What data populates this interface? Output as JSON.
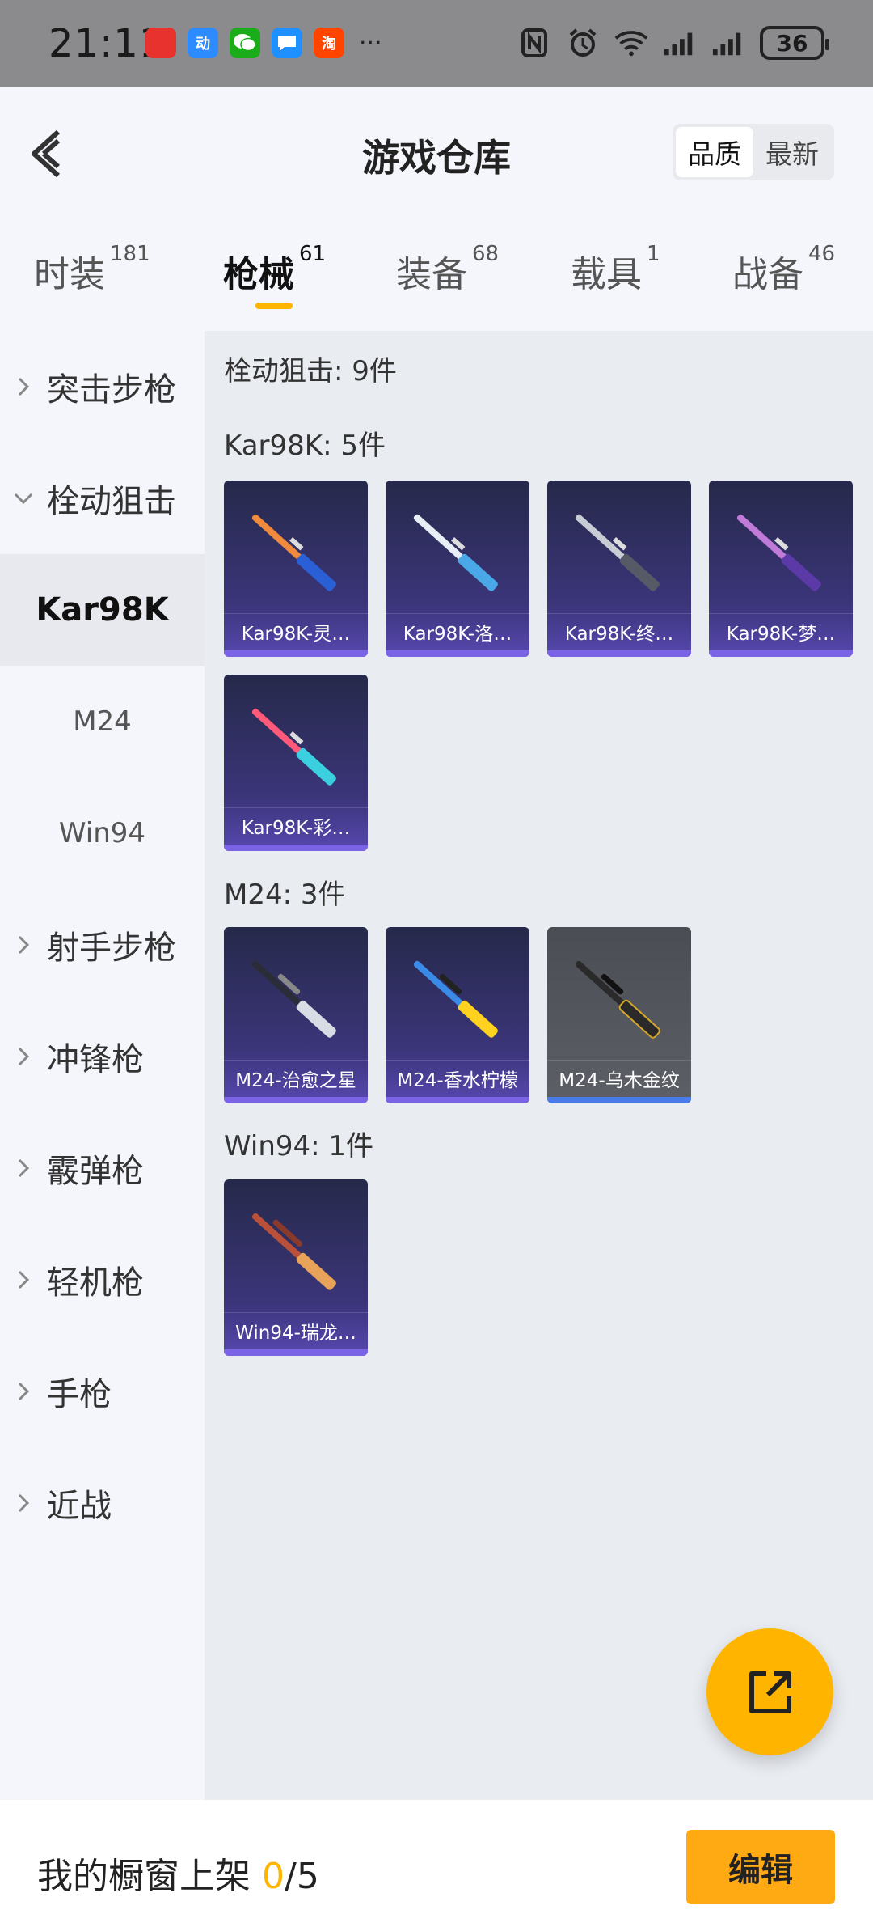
{
  "status_bar": {
    "time": "21:11",
    "apps": [
      {
        "icon": "game-app-icon",
        "text": "",
        "color": "#e8322d"
      },
      {
        "icon": "app-icon-blue",
        "text": "动",
        "color": "#2c8bff"
      },
      {
        "icon": "wechat-icon",
        "text": "",
        "color": "#1aad19"
      },
      {
        "icon": "message-icon",
        "text": "",
        "color": "#1e90ff"
      },
      {
        "icon": "taobao-icon",
        "text": "淘",
        "color": "#ff4400"
      }
    ],
    "more": "···",
    "battery": "36"
  },
  "header": {
    "title": "游戏仓库",
    "sort_options": [
      "品质",
      "最新"
    ],
    "sort_active": "品质"
  },
  "tabs": [
    {
      "label": "时装",
      "count": "181"
    },
    {
      "label": "枪械",
      "count": "61",
      "active": true
    },
    {
      "label": "装备",
      "count": "68"
    },
    {
      "label": "载具",
      "count": "1"
    },
    {
      "label": "战备",
      "count": "46"
    }
  ],
  "sidebar": {
    "categories": [
      {
        "label": "突击步枪",
        "expanded": false
      },
      {
        "label": "栓动狙击",
        "expanded": true
      },
      {
        "label": "射手步枪",
        "expanded": false
      },
      {
        "label": "冲锋枪",
        "expanded": false
      },
      {
        "label": "霰弹枪",
        "expanded": false
      },
      {
        "label": "轻机枪",
        "expanded": false
      },
      {
        "label": "手枪",
        "expanded": false
      },
      {
        "label": "近战",
        "expanded": false
      }
    ],
    "subitems": [
      {
        "label": "Kar98K",
        "active": true
      },
      {
        "label": "M24",
        "active": false
      },
      {
        "label": "Win94",
        "active": false
      }
    ]
  },
  "content": {
    "category_summary": "栓动狙击: 9件",
    "groups": [
      {
        "title": "Kar98K: 5件",
        "items": [
          {
            "label": "Kar98K-灵…",
            "colors": [
              "#f08a3c",
              "#2a5fd6"
            ]
          },
          {
            "label": "Kar98K-洛…",
            "colors": [
              "#e8eef5",
              "#4aa8e8"
            ]
          },
          {
            "label": "Kar98K-终…",
            "colors": [
              "#c8ccd4",
              "#555a66"
            ]
          },
          {
            "label": "Kar98K-梦…",
            "colors": [
              "#c07ad8",
              "#5b3aa8"
            ]
          },
          {
            "label": "Kar98K-彩…",
            "colors": [
              "#ff5a7a",
              "#3ad0e0"
            ]
          }
        ]
      },
      {
        "title": "M24: 3件",
        "items": [
          {
            "label": "M24-治愈之星",
            "colors": [
              "#d8dce4",
              "#2a2d38"
            ]
          },
          {
            "label": "M24-香水柠檬",
            "colors": [
              "#ffd21f",
              "#3a8be8"
            ]
          },
          {
            "label": "M24-乌木金纹",
            "colors": [
              "#2a2a2a",
              "#d4a72a"
            ],
            "grey": true
          }
        ]
      },
      {
        "title": "Win94: 1件",
        "items": [
          {
            "label": "Win94-瑞龙…",
            "colors": [
              "#b8503a",
              "#e8a25a"
            ]
          }
        ]
      }
    ]
  },
  "fab": {
    "icon": "share-external-icon"
  },
  "bottom": {
    "showcase_label": "我的橱窗上架 ",
    "showcase_count": "0",
    "showcase_total": "/5",
    "edit_label": "编辑"
  },
  "colors": {
    "accent": "#ffb400",
    "card_purple": "#3b357a"
  }
}
